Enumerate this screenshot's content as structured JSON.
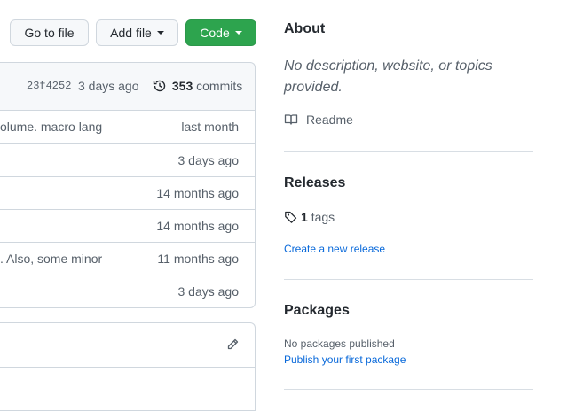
{
  "toolbar": {
    "go_to_file": "Go to file",
    "add_file": "Add file",
    "code": "Code"
  },
  "commit": {
    "sha": "23f4252",
    "when": "3 days ago",
    "count": "353",
    "count_label": "commits"
  },
  "files": [
    {
      "message": "olume. macro lang",
      "age": "last month"
    },
    {
      "message": "",
      "age": "3 days ago"
    },
    {
      "message": "",
      "age": "14 months ago"
    },
    {
      "message": "",
      "age": "14 months ago"
    },
    {
      "message": ". Also, some minor",
      "age": "11 months ago"
    },
    {
      "message": "",
      "age": "3 days ago"
    }
  ],
  "about": {
    "title": "About",
    "description": "No description, website, or topics provided.",
    "readme_label": "Readme"
  },
  "releases": {
    "title": "Releases",
    "tag_count": "1",
    "tag_label": "tags",
    "create_link": "Create a new release"
  },
  "packages": {
    "title": "Packages",
    "none_text": "No packages published",
    "publish_link": "Publish your first package"
  }
}
